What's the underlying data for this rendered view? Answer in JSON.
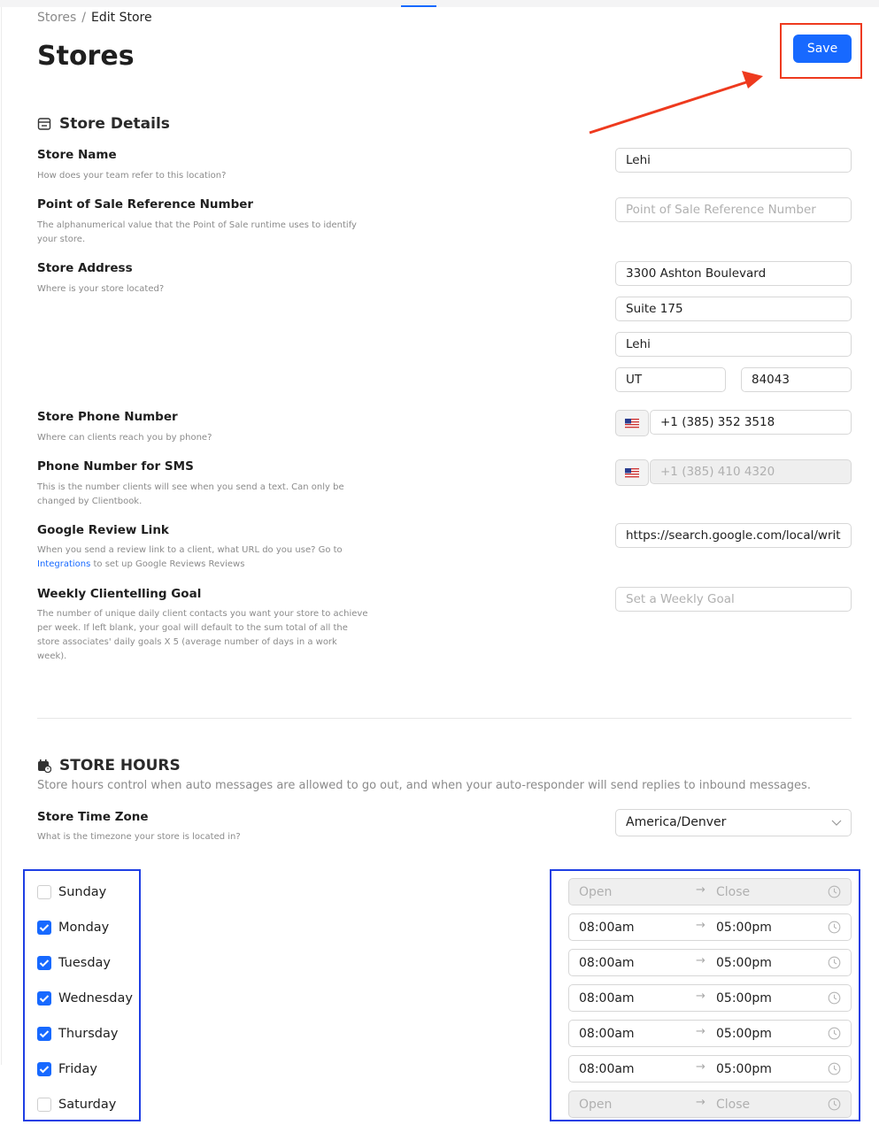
{
  "breadcrumb": {
    "parent": "Stores",
    "separator": "/",
    "current": "Edit Store"
  },
  "page_title": "Stores",
  "save_label": "Save",
  "details": {
    "heading": "Store Details",
    "store_name": {
      "label": "Store Name",
      "desc": "How does your team refer to this location?",
      "value": "Lehi"
    },
    "pos_ref": {
      "label": "Point of Sale Reference Number",
      "desc": "The alphanumerical value that the Point of Sale runtime uses to identify your store.",
      "placeholder": "Point of Sale Reference Number"
    },
    "address": {
      "label": "Store Address",
      "desc": "Where is your store located?",
      "line1": "3300 Ashton Boulevard",
      "line2": "Suite 175",
      "city": "Lehi",
      "state": "UT",
      "zip": "84043"
    },
    "phone": {
      "label": "Store Phone Number",
      "desc": "Where can clients reach you by phone?",
      "value": "+1 (385) 352 3518"
    },
    "sms": {
      "label": "Phone Number for SMS",
      "desc": "This is the number clients will see when you send a text. Can only be changed by Clientbook.",
      "value": "+1 (385) 410 4320"
    },
    "review": {
      "label": "Google Review Link",
      "desc_before": "When you send a review link to a client, what URL do you use? Go to",
      "desc_link": "Integrations",
      "desc_after": "to set up Google Reviews Reviews",
      "value": "https://search.google.com/local/writ"
    },
    "goal": {
      "label": "Weekly Clientelling Goal",
      "desc": "The number of unique daily client contacts you want your store to achieve per week. If left blank, your goal will default to the sum total of all the store associates' daily goals X 5 (average number of days in a work week).",
      "placeholder": "Set a Weekly Goal"
    }
  },
  "hours": {
    "heading": "STORE HOURS",
    "desc": "Store hours control when auto messages are allowed to go out, and when your auto-responder will send replies to inbound messages.",
    "timezone_label": "Store Time Zone",
    "timezone_desc": "What is the timezone your store is located in?",
    "timezone": "America/Denver",
    "arrow": "→",
    "days": [
      {
        "name": "Sunday",
        "checked": false,
        "open": "Open",
        "close": "Close"
      },
      {
        "name": "Monday",
        "checked": true,
        "open": "08:00am",
        "close": "05:00pm"
      },
      {
        "name": "Tuesday",
        "checked": true,
        "open": "08:00am",
        "close": "05:00pm"
      },
      {
        "name": "Wednesday",
        "checked": true,
        "open": "08:00am",
        "close": "05:00pm"
      },
      {
        "name": "Thursday",
        "checked": true,
        "open": "08:00am",
        "close": "05:00pm"
      },
      {
        "name": "Friday",
        "checked": true,
        "open": "08:00am",
        "close": "05:00pm"
      },
      {
        "name": "Saturday",
        "checked": false,
        "open": "Open",
        "close": "Close"
      }
    ]
  },
  "colors": {
    "accent": "#1769ff",
    "annotation_red": "#ee3a1e",
    "annotation_blue": "#1f3fe4"
  }
}
